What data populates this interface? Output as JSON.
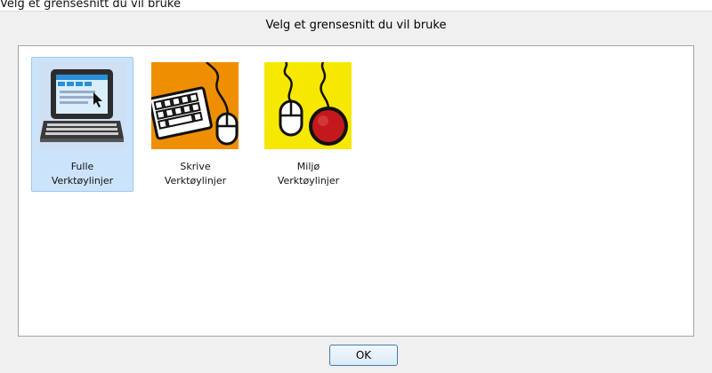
{
  "background_fragment": "Velg et grensesnitt du vil bruke",
  "dialog": {
    "title": "Velg et grensesnitt du vil bruke",
    "ok_label": "OK"
  },
  "options": [
    {
      "line1": "Fulle",
      "line2": "Verktøylinjer",
      "icon": "laptop-icon",
      "tile_color": "#cfe0f5",
      "selected": true
    },
    {
      "line1": "Skrive",
      "line2": "Verktøylinjer",
      "icon": "keyboard-mouse-icon",
      "tile_color": "#ef8f00",
      "selected": false
    },
    {
      "line1": "Miljø",
      "line2": "Verktøylinjer",
      "icon": "mouse-switch-icon",
      "tile_color": "#f7e800",
      "selected": false
    }
  ]
}
